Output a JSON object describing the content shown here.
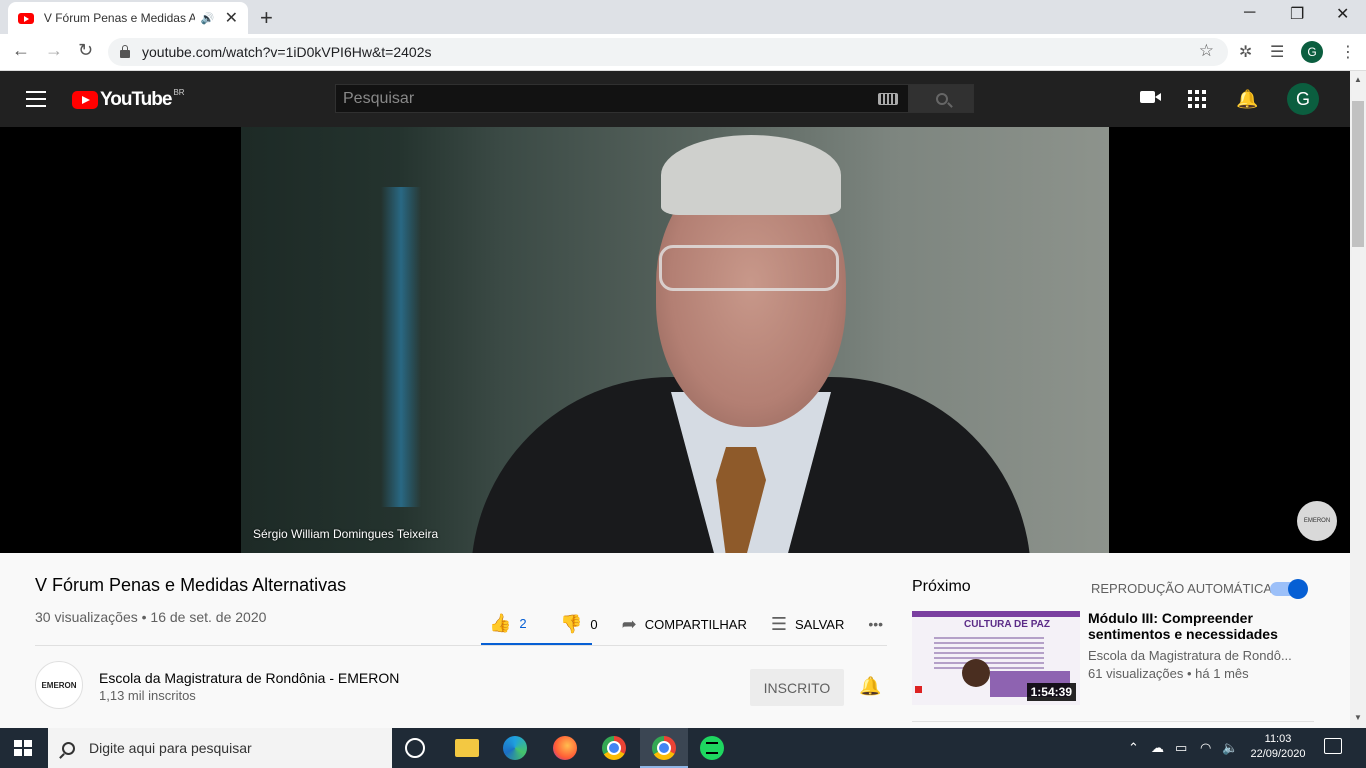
{
  "browser": {
    "tab_title": "V Fórum Penas e Medidas Al",
    "url": "youtube.com/watch?v=1iD0kVPI6Hw&t=2402s",
    "profile_initial": "G"
  },
  "youtube": {
    "logo_text": "YouTube",
    "country_code": "BR",
    "search_placeholder": "Pesquisar",
    "avatar_initial": "G"
  },
  "player": {
    "speaker_name": "Sérgio William Domingues Teixeira",
    "watermark": "EMERON"
  },
  "video": {
    "title": "V Fórum Penas e Medidas Alternativas",
    "views": "30 visualizações",
    "date": "16 de set. de 2020",
    "likes": "2",
    "dislikes": "0",
    "share_label": "COMPARTILHAR",
    "save_label": "SALVAR",
    "more_label": "•••"
  },
  "channel": {
    "avatar_text": "EMERON",
    "name": "Escola da Magistratura de Rondônia - EMERON",
    "subscribers": "1,13 mil inscritos",
    "subscribe_label": "INSCRITO"
  },
  "sidebar": {
    "up_next": "Próximo",
    "autoplay_label": "REPRODUÇÃO AUTOMÁTICA",
    "autoplay_on": true,
    "items": [
      {
        "title": "Módulo III: Compreender sentimentos e necessidades",
        "channel": "Escola da Magistratura de Rondô...",
        "views": "61 visualizações",
        "age": "há 1 mês",
        "duration": "1:54:39",
        "thumb_title": "CULTURA DE PAZ"
      }
    ]
  },
  "taskbar": {
    "search_text": "Digite aqui para pesquisar",
    "time": "11:03",
    "date": "22/09/2020"
  },
  "colors": {
    "youtube_red": "#ff0000",
    "accent_blue": "#065fd4",
    "header_bg": "#212121"
  }
}
